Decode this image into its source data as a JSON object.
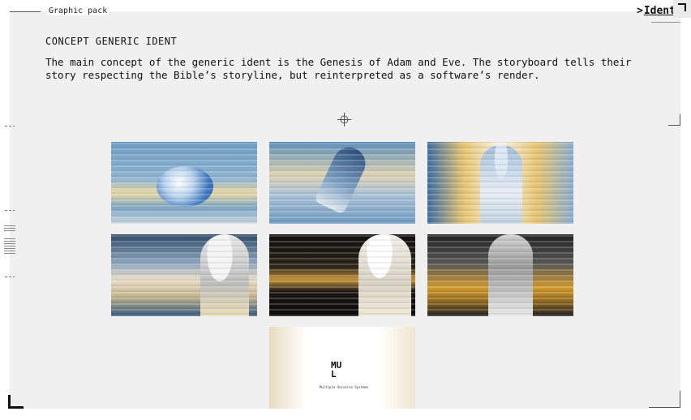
{
  "header": {
    "section_label": "Graphic pack",
    "nav_arrow": ">",
    "nav_link": "Ident"
  },
  "content": {
    "title": "CONCEPT GENERIC IDENT",
    "description": "The main concept of the generic ident is the Genesis of Adam and Eve. The storyboard tells their story respecting the Bible’s storyline, but reinterpreted as a software’s render."
  },
  "gallery": {
    "frames": [
      {
        "name": "earth-frame"
      },
      {
        "name": "hand-frame"
      },
      {
        "name": "statue-frame"
      },
      {
        "name": "glitch-figure-frame-1"
      },
      {
        "name": "glitch-figure-frame-2"
      },
      {
        "name": "glitch-figure-frame-3"
      },
      {
        "name": "logo-frame"
      }
    ],
    "logo_text_line1": "MU",
    "logo_text_line2": "L",
    "logo_caption": "Multiple Universe Systems"
  },
  "colors": {
    "panel": "#f0f0f0",
    "text": "#111111"
  }
}
